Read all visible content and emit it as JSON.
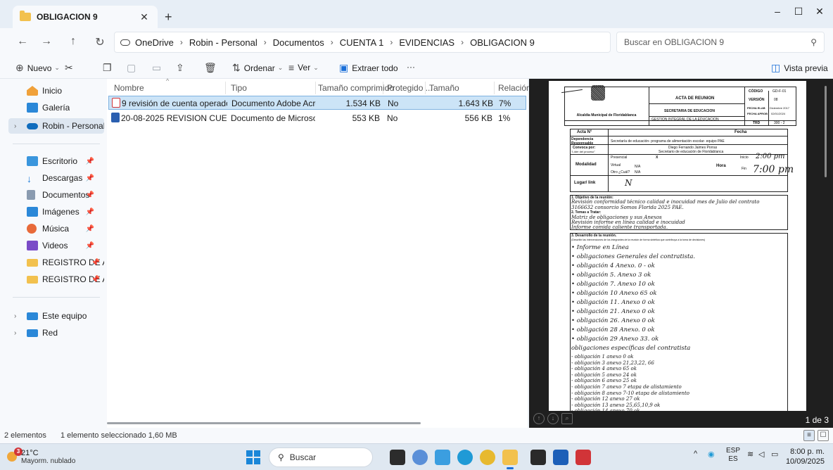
{
  "window": {
    "tab_title": "OBLIGACION 9",
    "minimize": "–",
    "maximize": "☐",
    "close": "✕",
    "tab_close": "✕",
    "new_tab": "+"
  },
  "address": {
    "breadcrumbs": [
      "OneDrive",
      "Robin - Personal",
      "Documentos",
      "CUENTA 1",
      "EVIDENCIAS",
      "OBLIGACION 9"
    ],
    "search_placeholder": "Buscar en OBLIGACION 9"
  },
  "toolbar": {
    "new_label": "Nuevo",
    "sort_label": "Ordenar",
    "view_label": "Ver",
    "extract_label": "Extraer todo",
    "more": "···",
    "preview_label": "Vista previa"
  },
  "sidebar": {
    "items": [
      {
        "label": "Inicio"
      },
      {
        "label": "Galería"
      },
      {
        "label": "Robin - Personal"
      },
      {
        "label": "Escritorio"
      },
      {
        "label": "Descargas"
      },
      {
        "label": "Documentos"
      },
      {
        "label": "Imágenes"
      },
      {
        "label": "Música"
      },
      {
        "label": "Videos"
      },
      {
        "label": "REGISTRO DE ASI"
      },
      {
        "label": "REGISTRO DE ASI"
      },
      {
        "label": "Este equipo"
      },
      {
        "label": "Red"
      }
    ]
  },
  "files": {
    "columns": [
      "Nombre",
      "Tipo",
      "Tamaño comprimido",
      "Protegido ...",
      "Tamaño",
      "Relación"
    ],
    "rows": [
      {
        "name": "9 revisión de cuenta operador mes ...",
        "type": "Documento Adobe Acrob...",
        "compressed": "1.534 KB",
        "protected": "No",
        "size": "1.643 KB",
        "ratio": "7%"
      },
      {
        "name": "20-08-2025  REVISION CUENTA O...",
        "type": "Documento de Microsoft ...",
        "compressed": "553 KB",
        "protected": "No",
        "size": "556 KB",
        "ratio": "1%"
      }
    ]
  },
  "preview": {
    "page_count": "1 de 3",
    "doc": {
      "title": "ACTA DE REUNION",
      "secretaria": "SECRETARIA DE EDUCACION",
      "gestion": "GESTION INTEGRAL DE LA EDUCACION",
      "alcaldia": "Alcaldía Municipal de Floridablanca",
      "codigo_label": "CÓDIGO",
      "codigo": "GD-F-01",
      "version_label": "VERSIÓN",
      "version": "08",
      "fecha_elab_label": "FECHA ELAB",
      "fecha_elab": "Diciembre 2017",
      "fecha_aprob_label": "FECHA APROB",
      "fecha_aprob": "02/01/2024",
      "trd_label": "TRD",
      "trd": "300 - 2",
      "acta_label": "Acta N°",
      "fecha_label": "Fecha",
      "dependencia_label": "Dependencia Responsable",
      "dependencia": "Secretaría de educación- programa de alimentación escolar- equipo PAE",
      "convoca_label": "Convoca por:",
      "lider_label": "\"Líder del proceso\"",
      "convoca_name": "Diego Fernando Jaimes Porras",
      "convoca_role": "Secretario de educación de Floridablanca",
      "modalidad_label": "Modalidad",
      "presencial": "Presencial",
      "virtual": "Virtual",
      "otro": "Otro ¿Cuál?",
      "x_mark": "X",
      "na1": "N/A",
      "na2": "N/A",
      "hora_label": "Hora",
      "inicio_label": "Inicio",
      "fin_label": "Fin",
      "hora_inicio": "2:00 pm",
      "hora_fin": "7:00 pm",
      "lugar_label": "Lugar/ link",
      "lugar": "N",
      "objetivo_label": "1.   Objetivo de la reunión:",
      "objetivo_1": "Revisión conformidad técnico calidad e inocuidad mes de Julio del contrato",
      "objetivo_2": "3166632 consorcio Somos Florida 2025  PAE.",
      "temas_label": "2.   Temas a Tratar:",
      "tema_1": "Matriz de obligaciones y sus Anexos",
      "tema_2": "Revisión informe en línea calidad e inocuidad",
      "tema_3": "Informe comida caliente transportada.",
      "desarrollo_label": "3. Desarrollo de la reunión.",
      "desarrollo_note": "(Describir las intervenciones de los integrantes de la reunión de forma sintética que contribuya a la toma de decisiones)",
      "notes": [
        "• Informe en Línea",
        "• obligaciones Generales del contratista.",
        "• obligación 4 Anexo. 0 - ok",
        "• obligación 5. Anexo 3 ok",
        "• obligación 7. Anexo 10 ok",
        "• obligación 10 Anexo 65 ok",
        "• obligación 11. Anexo 0 ok",
        "• obligación 21. Anexo 0 ok",
        "• obligación 26. Anexo 0 ok",
        "• obligación 28 Anexo. 0 ok",
        "• obligación 29 Anexo 33. ok",
        "obligaciones específicas del contratista",
        "- obligación 1 anexo 0 ok",
        "- obligación 3 anexo 21,23,22, 66",
        "- obligación 4 anexo 65 ok",
        "- obligación 5 anexo 24 ok",
        "- obligación 6 anexo 25 ok",
        "- obligación 7 anexo 7 etapa de alistamiento",
        "- obligación 8 anexo 7-10 etapa de alistamiento",
        "- obligación 12 anexo 27 ok",
        "- obligación 13 anexo 25,65,10,9 ok",
        "- obligación 14 anexo 70 ok"
      ]
    }
  },
  "status": {
    "count": "2 elementos",
    "selected": "1 elemento seleccionado  1,60 MB"
  },
  "taskbar": {
    "temp": "21°C",
    "weather": "Mayorm. nublado",
    "badge": "3",
    "search": "Buscar",
    "lang1": "ESP",
    "lang2": "ES",
    "time": "8:00 p. m.",
    "date": "10/09/2025"
  },
  "colors": {
    "accent": "#0067c0",
    "selection": "#cce4f7",
    "folder": "#f2c14e"
  }
}
